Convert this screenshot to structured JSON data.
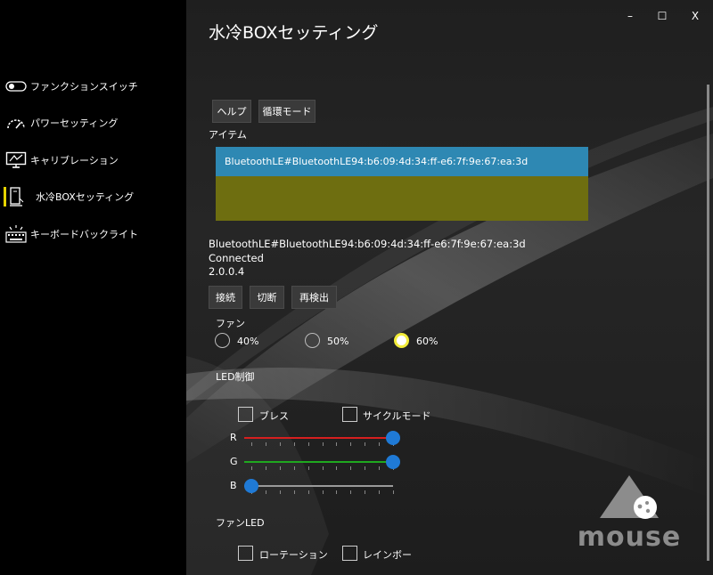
{
  "window": {
    "title": "水冷BOXセッティング",
    "controls": {
      "minimize": "–",
      "maximize": "☐",
      "close": "X"
    }
  },
  "sidebar": {
    "items": [
      {
        "label": "ファンクションスイッチ",
        "icon": "toggle-icon",
        "selected": false
      },
      {
        "label": "パワーセッティング",
        "icon": "gauge-icon",
        "selected": false
      },
      {
        "label": "キャリブレーション",
        "icon": "monitor-icon",
        "selected": false
      },
      {
        "label": "水冷BOXセッティング",
        "icon": "pc-case-icon",
        "selected": true
      },
      {
        "label": "キーボードバックライト",
        "icon": "keyboard-light-icon",
        "selected": false
      }
    ],
    "accent": "#e6d300"
  },
  "toolbar": {
    "help_label": "ヘルプ",
    "cycle_label": "循環モード"
  },
  "items": {
    "label": "アイテム",
    "rows": [
      "BluetoothLE#BluetoothLE94:b6:09:4d:34:ff-e6:7f:9e:67:ea:3d"
    ],
    "selected_color": "#2e88b3",
    "panel_color": "#6e6e10"
  },
  "device": {
    "id": "BluetoothLE#BluetoothLE94:b6:09:4d:34:ff-e6:7f:9e:67:ea:3d",
    "status": "Connected",
    "version": "2.0.0.4"
  },
  "actions": {
    "connect": "接続",
    "disconnect": "切断",
    "rescan": "再検出"
  },
  "fan": {
    "label": "ファン",
    "options": [
      "40%",
      "50%",
      "60%"
    ],
    "selected": "60%"
  },
  "led": {
    "label": "LED制御",
    "breath_label": "ブレス",
    "cycle_label": "サイクルモード",
    "sliders": [
      {
        "name": "R",
        "value": 1.0,
        "color": "#d61f1f"
      },
      {
        "name": "G",
        "value": 1.0,
        "color": "#1fa81f"
      },
      {
        "name": "B",
        "value": 0.0,
        "color": "#9a9a9a"
      }
    ]
  },
  "fan_led": {
    "label": "ファンLED",
    "rotation_label": "ローテーション",
    "rainbow_label": "レインボー"
  },
  "brand": {
    "logo_text": "mouse"
  },
  "colors": {
    "slider_thumb": "#1f7ad6",
    "radio_checked": "#f2ec3a"
  }
}
